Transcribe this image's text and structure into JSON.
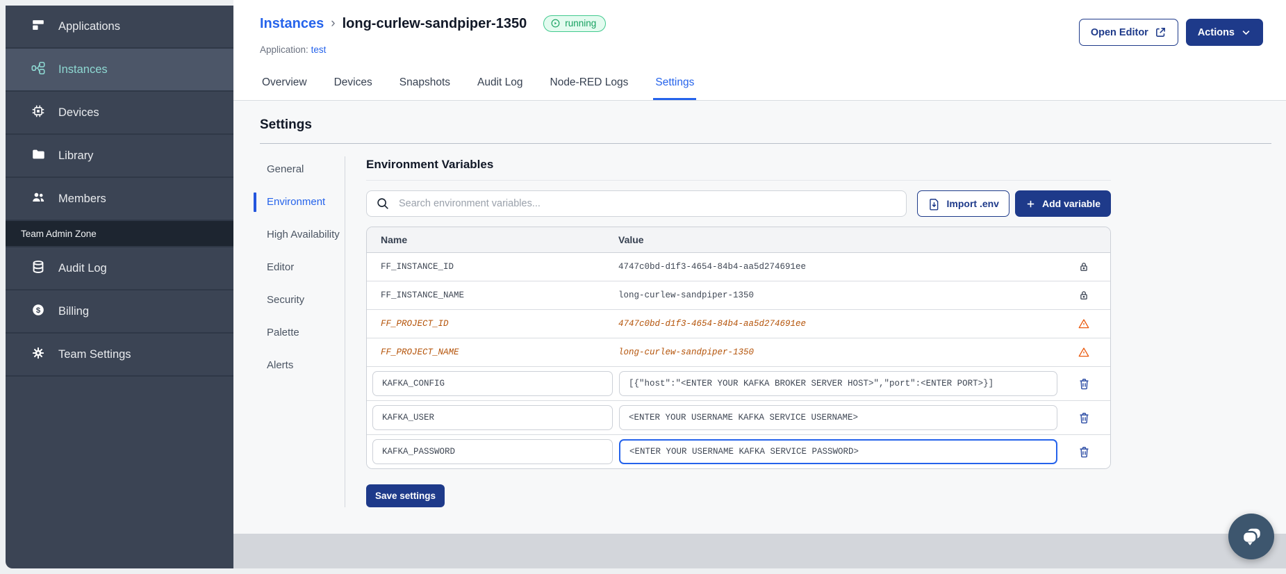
{
  "colors": {
    "primary_blue": "#1e3a8a",
    "link_blue": "#2563eb",
    "sidebar_bg": "#3b4454",
    "sidebar_active_teal": "#8ed8d2",
    "running_green": "#16a05f",
    "deprecated_orange": "#b45309",
    "warning_icon_orange": "#ea580c",
    "footer_gray": "#d3d6db"
  },
  "sidebar": {
    "items": [
      {
        "label": "Applications"
      },
      {
        "label": "Instances",
        "active": true
      },
      {
        "label": "Devices"
      },
      {
        "label": "Library"
      },
      {
        "label": "Members"
      }
    ],
    "section_label": "Team Admin Zone",
    "admin_items": [
      {
        "label": "Audit Log"
      },
      {
        "label": "Billing"
      },
      {
        "label": "Team Settings"
      }
    ]
  },
  "header": {
    "breadcrumb_parent": "Instances",
    "breadcrumb_separator": "›",
    "instance_name": "long-curlew-sandpiper-1350",
    "status_badge": "running",
    "application_label": "Application:",
    "application_name": "test",
    "open_editor_label": "Open Editor",
    "actions_label": "Actions"
  },
  "tabs": [
    {
      "label": "Overview"
    },
    {
      "label": "Devices"
    },
    {
      "label": "Snapshots"
    },
    {
      "label": "Audit Log"
    },
    {
      "label": "Node-RED Logs"
    },
    {
      "label": "Settings",
      "active": true
    }
  ],
  "settings": {
    "title": "Settings",
    "nav": [
      {
        "label": "General"
      },
      {
        "label": "Environment",
        "active": true
      },
      {
        "label": "High Availability"
      },
      {
        "label": "Editor"
      },
      {
        "label": "Security"
      },
      {
        "label": "Palette"
      },
      {
        "label": "Alerts"
      }
    ],
    "env": {
      "title": "Environment Variables",
      "search_placeholder": "Search environment variables...",
      "import_label": "Import .env",
      "add_label": "Add variable",
      "columns": {
        "name": "Name",
        "value": "Value"
      },
      "rows": [
        {
          "name": "FF_INSTANCE_ID",
          "value": "4747c0bd-d1f3-4654-84b4-aa5d274691ee",
          "state": "locked"
        },
        {
          "name": "FF_INSTANCE_NAME",
          "value": "long-curlew-sandpiper-1350",
          "state": "locked"
        },
        {
          "name": "FF_PROJECT_ID",
          "value": "4747c0bd-d1f3-4654-84b4-aa5d274691ee",
          "state": "deprecated"
        },
        {
          "name": "FF_PROJECT_NAME",
          "value": "long-curlew-sandpiper-1350",
          "state": "deprecated"
        },
        {
          "name": "KAFKA_CONFIG",
          "value": "[{\"host\":\"<ENTER YOUR KAFKA BROKER SERVER HOST>\",\"port\":<ENTER PORT>}]",
          "state": "editable"
        },
        {
          "name": "KAFKA_USER",
          "value": "<ENTER YOUR USERNAME KAFKA SERVICE USERNAME>",
          "state": "editable"
        },
        {
          "name": "KAFKA_PASSWORD",
          "value": "<ENTER YOUR USERNAME KAFKA SERVICE PASSWORD>",
          "state": "editable-focused"
        }
      ],
      "save_label": "Save settings"
    }
  }
}
